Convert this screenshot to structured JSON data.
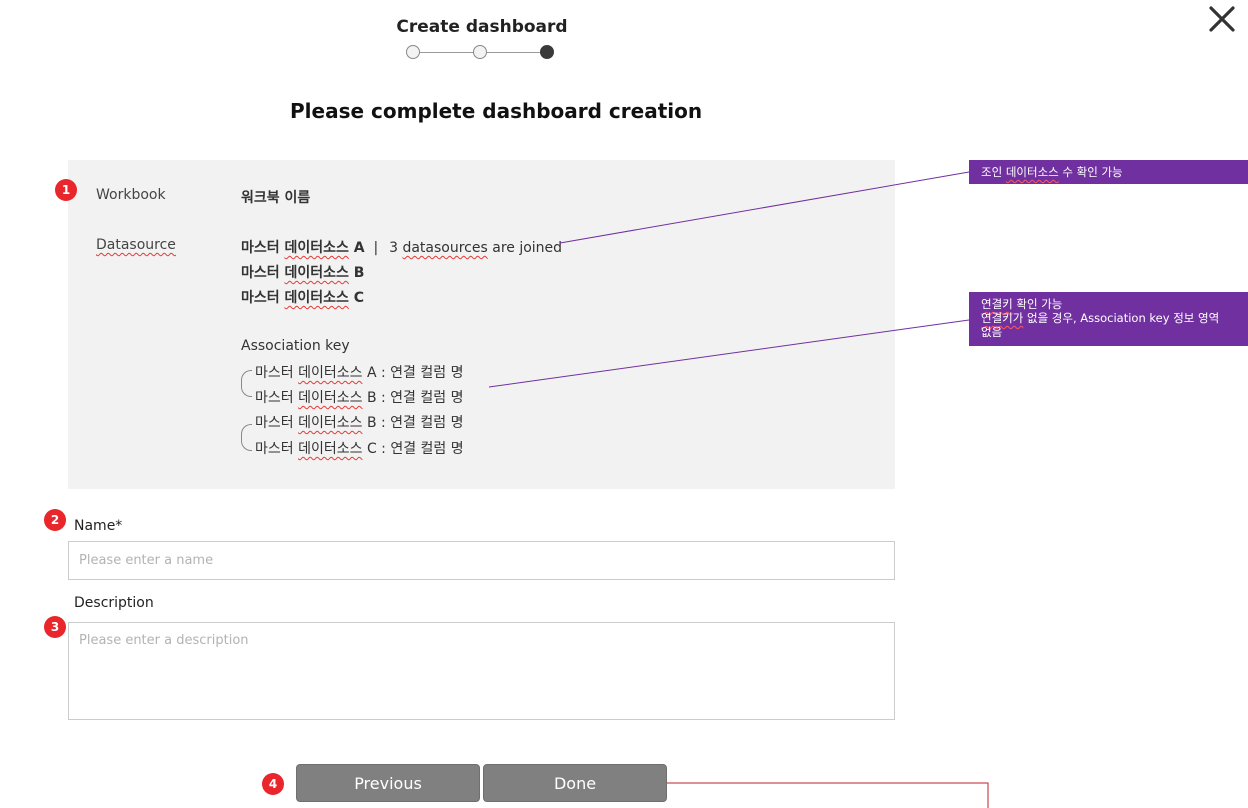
{
  "header": {
    "title": "Create dashboard",
    "steps_total": 3,
    "current_step": 3
  },
  "page_heading": "Please complete dashboard creation",
  "info": {
    "badge": "1",
    "workbook_label": "Workbook",
    "workbook_value": "워크북 이름",
    "datasource_label": "Datasource",
    "datasources": [
      "마스터 데이터소스 A",
      "마스터 데이터소스 B",
      "마스터 데이터소스 C"
    ],
    "separator": "|",
    "joined_text": "3 datasources are joined",
    "association_key_label": "Association key",
    "association_keys": [
      {
        "prefix": "마스터",
        "ds": "데이터소스",
        "suffix": "A : 연결 컬럼 명"
      },
      {
        "prefix": "마스터",
        "ds": "데이터소스",
        "suffix": "B : 연결 컬럼 명"
      },
      {
        "prefix": "마스터",
        "ds": "데이터소스",
        "suffix": "B : 연결 컬럼 명"
      },
      {
        "prefix": "마스터",
        "ds": "데이터소스",
        "suffix": "C : 연결 컬럼 명"
      }
    ]
  },
  "form": {
    "name_badge": "2",
    "name_label": "Name*",
    "name_placeholder": "Please enter a name",
    "name_value": "",
    "desc_badge": "3",
    "desc_label": "Description",
    "desc_placeholder": "Please enter a description",
    "desc_value": ""
  },
  "buttons": {
    "badge": "4",
    "previous": "Previous",
    "done": "Done"
  },
  "notes": {
    "join_count": {
      "pre": "조인",
      "wavy": "데이터소스",
      "post": "수 확인 가능"
    },
    "assoc_key_line1": {
      "wavy": "연결키",
      "post": "확인 가능"
    },
    "assoc_key_line2": {
      "wavy": "연결키가",
      "post": "없을 경우, Association key 정보 영역"
    },
    "assoc_key_line3": "없음"
  },
  "colors": {
    "accent_note": "#7030a0",
    "badge": "#e8262b",
    "button": "#808080",
    "panel": "#f2f2f2",
    "connector_red": "#c0202a"
  }
}
